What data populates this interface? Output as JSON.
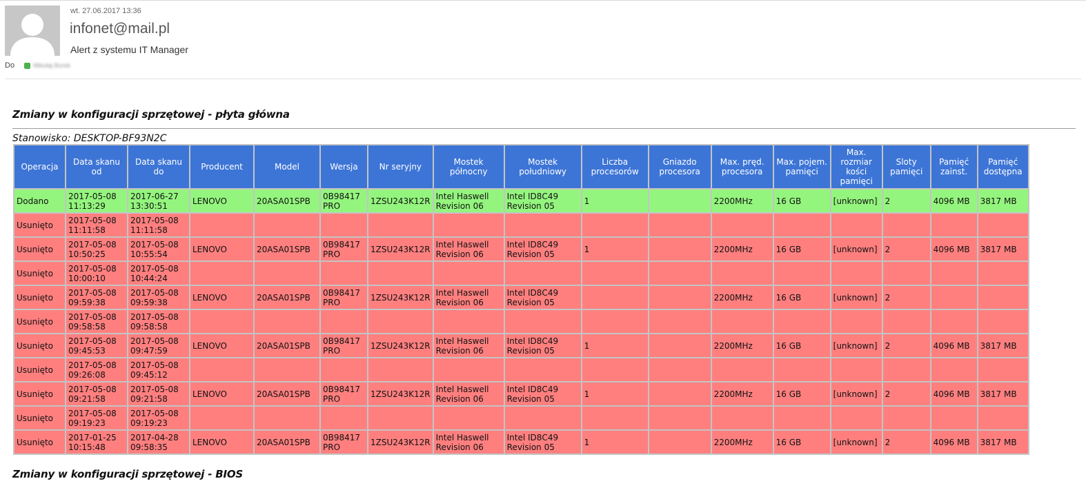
{
  "message": {
    "date": "wt. 27.06.2017 13:36",
    "from": "infonet@mail.pl",
    "subject": "Alert z systemu IT Manager",
    "to_label": "Do",
    "recipient": "Mikołaj Borek"
  },
  "sections": {
    "motherboard_title": "Zmiany w konfiguracji sprzętowej - płyta główna",
    "station": "Stanowisko: DESKTOP-BF93N2C",
    "bios_title": "Zmiany w konfiguracji sprzętowej - BIOS"
  },
  "colors": {
    "header": "#3d75d6",
    "added": "#94f57e",
    "removed": "#ff7f7f"
  },
  "table": {
    "headers": [
      "Operacja",
      "Data skanu od",
      "Data skanu do",
      "Producent",
      "Model",
      "Wersja",
      "Nr seryjny",
      "Mostek północny",
      "Mostek południowy",
      "Liczba procesorów",
      "Gniazdo procesora",
      "Max. pręd. procesora",
      "Max. pojem. pamięci",
      "Max. rozmiar kości pamięci",
      "Sloty pamięci",
      "Pamięć zainst.",
      "Pamięć dostępna"
    ],
    "rows": [
      {
        "status": "added",
        "cells": [
          "Dodano",
          "2017-05-08\n11:13:29",
          "2017-06-27\n13:30:51",
          "LENOVO",
          "20ASA01SPB",
          "0B98417\nPRO",
          "1ZSU243K12R",
          "Intel Haswell\nRevision 06",
          "Intel ID8C49\nRevision 05",
          "1",
          "",
          "2200MHz",
          "16 GB",
          "[unknown]",
          "2",
          "4096 MB",
          "3817 MB"
        ]
      },
      {
        "status": "removed",
        "cells": [
          "Usunięto",
          "2017-05-08\n11:11:58",
          "2017-05-08\n11:11:58",
          "",
          "",
          "",
          "",
          "",
          "",
          "",
          "",
          "",
          "",
          "",
          "",
          "",
          ""
        ]
      },
      {
        "status": "removed",
        "cells": [
          "Usunięto",
          "2017-05-08\n10:50:25",
          "2017-05-08\n10:55:54",
          "LENOVO",
          "20ASA01SPB",
          "0B98417\nPRO",
          "1ZSU243K12R",
          "Intel Haswell\nRevision 06",
          "Intel ID8C49\nRevision 05",
          "1",
          "",
          "2200MHz",
          "16 GB",
          "[unknown]",
          "2",
          "4096 MB",
          "3817 MB"
        ]
      },
      {
        "status": "removed",
        "cells": [
          "Usunięto",
          "2017-05-08\n10:00:10",
          "2017-05-08\n10:44:24",
          "",
          "",
          "",
          "",
          "",
          "",
          "",
          "",
          "",
          "",
          "",
          "",
          "",
          ""
        ]
      },
      {
        "status": "removed",
        "cells": [
          "Usunięto",
          "2017-05-08\n09:59:38",
          "2017-05-08\n09:59:38",
          "LENOVO",
          "20ASA01SPB",
          "0B98417\nPRO",
          "1ZSU243K12R",
          "Intel Haswell\nRevision 06",
          "Intel ID8C49\nRevision 05",
          "",
          "",
          "2200MHz",
          "16 GB",
          "[unknown]",
          "2",
          "",
          ""
        ]
      },
      {
        "status": "removed",
        "cells": [
          "Usunięto",
          "2017-05-08\n09:58:58",
          "2017-05-08\n09:58:58",
          "",
          "",
          "",
          "",
          "",
          "",
          "",
          "",
          "",
          "",
          "",
          "",
          "",
          ""
        ]
      },
      {
        "status": "removed",
        "cells": [
          "Usunięto",
          "2017-05-08\n09:45:53",
          "2017-05-08\n09:47:59",
          "LENOVO",
          "20ASA01SPB",
          "0B98417\nPRO",
          "1ZSU243K12R",
          "Intel Haswell\nRevision 06",
          "Intel ID8C49\nRevision 05",
          "1",
          "",
          "2200MHz",
          "16 GB",
          "[unknown]",
          "2",
          "4096 MB",
          "3817 MB"
        ]
      },
      {
        "status": "removed",
        "cells": [
          "Usunięto",
          "2017-05-08\n09:26:08",
          "2017-05-08\n09:45:12",
          "",
          "",
          "",
          "",
          "",
          "",
          "",
          "",
          "",
          "",
          "",
          "",
          "",
          ""
        ]
      },
      {
        "status": "removed",
        "cells": [
          "Usunięto",
          "2017-05-08\n09:21:58",
          "2017-05-08\n09:21:58",
          "LENOVO",
          "20ASA01SPB",
          "0B98417\nPRO",
          "1ZSU243K12R",
          "Intel Haswell\nRevision 06",
          "Intel ID8C49\nRevision 05",
          "1",
          "",
          "2200MHz",
          "16 GB",
          "[unknown]",
          "2",
          "4096 MB",
          "3817 MB"
        ]
      },
      {
        "status": "removed",
        "cells": [
          "Usunięto",
          "2017-05-08\n09:19:23",
          "2017-05-08\n09:19:23",
          "",
          "",
          "",
          "",
          "",
          "",
          "",
          "",
          "",
          "",
          "",
          "",
          "",
          ""
        ]
      },
      {
        "status": "removed",
        "cells": [
          "Usunięto",
          "2017-01-25\n10:15:48",
          "2017-04-28\n09:58:35",
          "LENOVO",
          "20ASA01SPB",
          "0B98417\nPRO",
          "1ZSU243K12R",
          "Intel Haswell\nRevision 06",
          "Intel ID8C49\nRevision 05",
          "1",
          "",
          "2200MHz",
          "16 GB",
          "[unknown]",
          "2",
          "4096 MB",
          "3817 MB"
        ]
      }
    ]
  }
}
